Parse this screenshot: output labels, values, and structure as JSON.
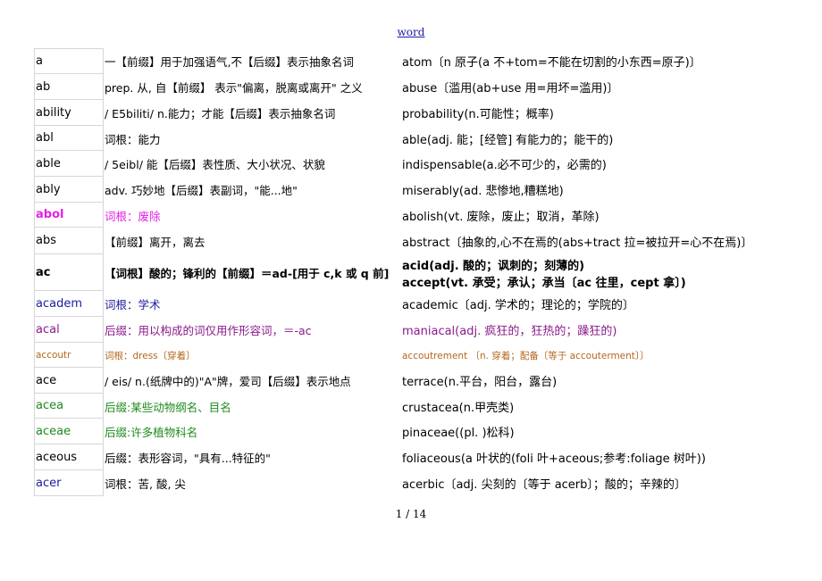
{
  "header": {
    "title": "word"
  },
  "footer": {
    "page": "1 / 14"
  },
  "rows": [
    {
      "word": "a",
      "def": "一【前缀】用于加强语气,不【后缀】表示抽象名词",
      "ex": "atom〔n 原子(a 不+tom=不能在切割的小东西=原子)〕",
      "color": "#000000"
    },
    {
      "word": "ab",
      "def": "prep. 从, 自【前缀】 表示\"偏离，脱离或离开\" 之义",
      "ex": "abuse〔滥用(ab+use 用=用坏=滥用)〕",
      "color": "#000000"
    },
    {
      "word": "ability",
      "def": "/ E5biliti/  n.能力；才能【后缀】表示抽象名词",
      "ex": "probability(n.可能性；概率)",
      "color": "#000000"
    },
    {
      "word": "abl",
      "def": "词根：能力",
      "ex": "able(adj. 能；[经管] 有能力的；能干的)",
      "color": "#000000"
    },
    {
      "word": "able",
      "def": "/ 5eibl/  能【后缀】表性质、大小状况、状貌",
      "ex": "indispensable(a.必不可少的，必需的)",
      "color": "#000000"
    },
    {
      "word": "ably",
      "def": "adv. 巧妙地【后缀】表副词，\"能...地\"",
      "ex": "miserably(ad. 悲惨地,糟糕地)",
      "color": "#000000"
    },
    {
      "word": "abol",
      "def": "词根：废除",
      "ex": "abolish(vt. 废除，废止；取消，革除)",
      "color": "#e61ee6",
      "ex_color": "#000000",
      "bold_word": true
    },
    {
      "word": "abs",
      "def": "【前缀】离开，离去",
      "ex": "abstract〔抽象的,心不在焉的(abs+tract 拉=被拉开=心不在焉)〕",
      "color": "#000000"
    },
    {
      "word": "ac",
      "def": "【词根】酸的；锋利的【前缀】＝ad-[用于 c,k 或 q 前]",
      "ex": "acid(adj. 酸的；讽刺的；刻薄的)",
      "ex2": "accept(vt. 承受；承认；承当〔ac 往里，cept 拿〕)",
      "color": "#000000",
      "bold_all": true
    },
    {
      "word": "academ",
      "def": "词根：学术",
      "ex": "academic〔adj. 学术的；理论的；学院的〕",
      "color": "#1c1c9c",
      "ex_color": "#000000"
    },
    {
      "word": "acal",
      "def": "后缀：用以构成的词仅用作形容词，＝-ac",
      "ex": "maniacal(adj. 疯狂的，狂热的；躁狂的)",
      "color": "#8a1a8a"
    },
    {
      "word": "accoutr",
      "def": "词根：dress〔穿着〕",
      "ex": "accoutrement 〔n. 穿着；配备〔等于 accouterment〕〕",
      "color": "#b5651d",
      "small": true
    },
    {
      "word": "ace",
      "def": "/ eis/  n.(纸牌中的)\"A\"牌，爱司【后缀】表示地点",
      "ex": "terrace(n.平台，阳台，露台)",
      "color": "#000000"
    },
    {
      "word": "acea",
      "def": "后缀:某些动物纲名、目名",
      "ex": "crustacea(n.甲壳类)",
      "color": "#1d8a1d",
      "ex_color": "#000000"
    },
    {
      "word": "aceae",
      "def": "后缀:许多植物科名",
      "ex": "pinaceae((pl. )松科)",
      "color": "#1d8a1d",
      "ex_color": "#000000"
    },
    {
      "word": "aceous",
      "def": "后缀：表形容词，\"具有...特征的\"",
      "ex": "foliaceous(a 叶状的(foli 叶+aceous;参考:foliage 树叶))",
      "color": "#000000"
    },
    {
      "word": "acer",
      "def": "词根：苦, 酸, 尖",
      "ex": "acerbic〔adj. 尖刻的〔等于 acerb〕；酸的；辛辣的〕",
      "color": "#1c1c9c",
      "ex_color": "#000000",
      "def_color": "#000000"
    }
  ]
}
